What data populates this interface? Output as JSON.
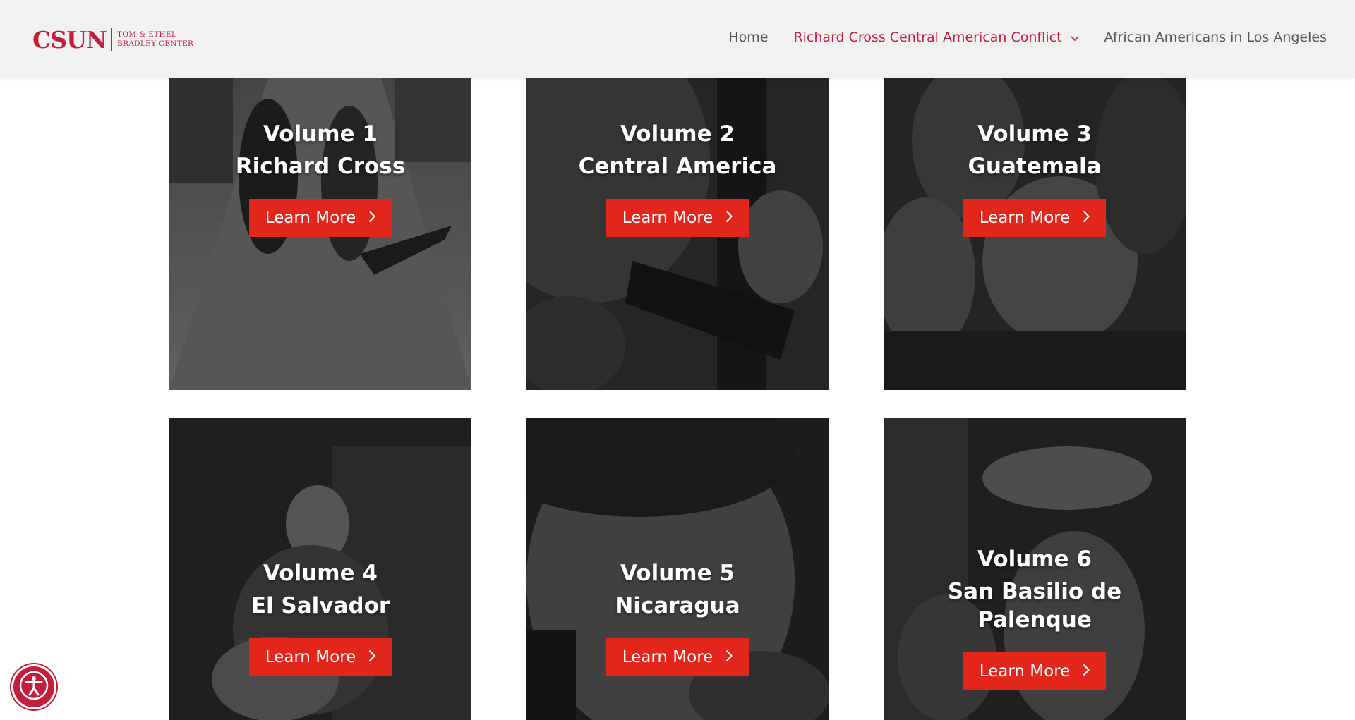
{
  "header": {
    "logo_word": "CSUN",
    "logo_sub_line1": "TOM & ETHEL",
    "logo_sub_line2": "BRADLEY CENTER",
    "nav": [
      {
        "label": "Home",
        "active": false
      },
      {
        "label": "Richard Cross Central American Conflict",
        "active": true,
        "has_dropdown": true
      },
      {
        "label": "African Americans in Los Angeles",
        "active": false
      }
    ]
  },
  "cards": [
    {
      "volume": "Volume 1",
      "subtitle": "Richard Cross",
      "button": "Learn More"
    },
    {
      "volume": "Volume 2",
      "subtitle": "Central America",
      "button": "Learn More"
    },
    {
      "volume": "Volume 3",
      "subtitle": "Guatemala",
      "button": "Learn More"
    },
    {
      "volume": "Volume 4",
      "subtitle": "El Salvador",
      "button": "Learn More"
    },
    {
      "volume": "Volume 5",
      "subtitle": "Nicaragua",
      "button": "Learn More"
    },
    {
      "volume": "Volume 6",
      "subtitle": "San Basilio de Palenque",
      "button": "Learn More"
    }
  ],
  "colors": {
    "brand_red": "#c41e3a",
    "button_red": "#e3261c",
    "header_bg": "#f1f1f1",
    "nav_text": "#555555"
  },
  "icons": {
    "nav_dropdown": "chevron-down-icon",
    "button_arrow": "chevron-right-icon",
    "accessibility": "accessibility-icon"
  }
}
